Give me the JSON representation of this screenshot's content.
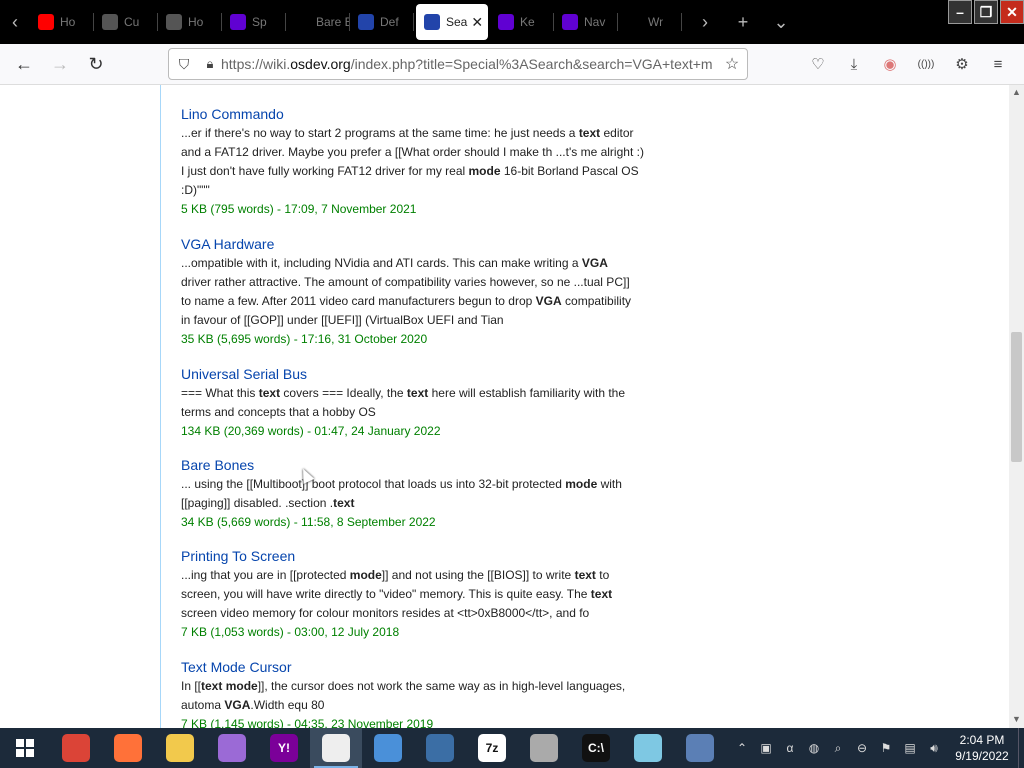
{
  "browser": {
    "tabs": [
      {
        "label": "Ho",
        "icon": "youtube-icon",
        "color": "#ff0000"
      },
      {
        "label": "Cu",
        "icon": "binary-icon",
        "color": "#555555"
      },
      {
        "label": "Ho",
        "icon": "binary-icon",
        "color": "#555555"
      },
      {
        "label": "Sp",
        "icon": "yahoo-icon",
        "color": "#6001d2"
      },
      {
        "label": "Bare Bon",
        "icon": "blank-icon",
        "color": "#000000"
      },
      {
        "label": "Def",
        "icon": "osdev-icon",
        "color": "#2244aa"
      },
      {
        "label": "Sea",
        "icon": "osdev-icon",
        "color": "#2244aa",
        "active": true
      },
      {
        "label": "Ke",
        "icon": "yahoo-icon",
        "color": "#6001d2"
      },
      {
        "label": "Nav",
        "icon": "yahoo-icon",
        "color": "#6001d2"
      },
      {
        "label": "Wr",
        "icon": "blank-icon",
        "color": "#000000"
      }
    ],
    "url_prefix": "https://wiki.",
    "url_domain": "osdev.org",
    "url_rest": "/index.php?title=Special%3ASearch&search=VGA+text+m"
  },
  "results": [
    {
      "title": "Lino Commando",
      "snippet": [
        [
          {
            "t": "...er if there's no way to start 2 programs at the same time: he just needs a "
          },
          {
            "t": "text",
            "b": true
          },
          {
            "t": " editor"
          }
        ],
        [
          {
            "t": "and a FAT12 driver. Maybe you prefer a [[What order should I make th ...t's me alright :)"
          }
        ],
        [
          {
            "t": "I just don't have fully working FAT12 driver for my real "
          },
          {
            "t": "mode",
            "b": true
          },
          {
            "t": " 16-bit Borland Pascal OS"
          }
        ],
        [
          {
            "t": ":D)\"\"\""
          }
        ]
      ],
      "meta": "5 KB (795 words) - 17:09, 7 November 2021"
    },
    {
      "title": "VGA Hardware",
      "snippet": [
        [
          {
            "t": "...ompatible with it, including NVidia and ATI cards. This can make writing a "
          },
          {
            "t": "VGA",
            "b": true
          }
        ],
        [
          {
            "t": "driver rather attractive. The amount of compatibility varies however, so ne ...tual PC]]"
          }
        ],
        [
          {
            "t": "to name a few. After 2011 video card manufacturers begun to drop "
          },
          {
            "t": "VGA",
            "b": true
          },
          {
            "t": " compatibility"
          }
        ],
        [
          {
            "t": "in favour of [[GOP]] under [[UEFI]] (VirtualBox UEFI and Tian"
          }
        ]
      ],
      "meta": "35 KB (5,695 words) - 17:16, 31 October 2020"
    },
    {
      "title": "Universal Serial Bus",
      "snippet": [
        [
          {
            "t": "=== What this "
          },
          {
            "t": "text",
            "b": true
          },
          {
            "t": " covers === Ideally, the "
          },
          {
            "t": "text",
            "b": true
          },
          {
            "t": " here will establish familiarity with the"
          }
        ],
        [
          {
            "t": "terms and concepts that a hobby OS"
          }
        ]
      ],
      "meta": "134 KB (20,369 words) - 01:47, 24 January 2022"
    },
    {
      "title": "Bare Bones",
      "snippet": [
        [
          {
            "t": "... using the [[Multiboot]] boot protocol that loads us into 32-bit protected "
          },
          {
            "t": "mode",
            "b": true
          },
          {
            "t": " with"
          }
        ],
        [
          {
            "t": "[[paging]] disabled. .section ."
          },
          {
            "t": "text",
            "b": true
          }
        ]
      ],
      "meta": "34 KB (5,669 words) - 11:58, 8 September 2022"
    },
    {
      "title": "Printing To Screen",
      "snippet": [
        [
          {
            "t": "...ing that you are in [[protected "
          },
          {
            "t": "mode",
            "b": true
          },
          {
            "t": "]] and not using the [[BIOS]] to write "
          },
          {
            "t": "text",
            "b": true
          },
          {
            "t": " to"
          }
        ],
        [
          {
            "t": "screen, you will have write directly to \"video\" memory. This is quite easy. The "
          },
          {
            "t": "text",
            "b": true
          }
        ],
        [
          {
            "t": "screen video memory for colour monitors resides at <tt>0xB8000</tt>, and fo"
          }
        ]
      ],
      "meta": "7 KB (1,053 words) - 03:00, 12 July 2018"
    },
    {
      "title": "Text Mode Cursor",
      "snippet": [
        [
          {
            "t": "In [["
          },
          {
            "t": "text mode",
            "b": true
          },
          {
            "t": "]], the cursor does not work the same way as in high-level languages,"
          }
        ],
        [
          {
            "t": "automa "
          },
          {
            "t": "VGA",
            "b": true
          },
          {
            "t": ".Width equ 80"
          }
        ]
      ],
      "meta": "7 KB (1,145 words) - 04:35, 23 November 2019"
    }
  ],
  "taskbar": {
    "apps": [
      {
        "name": "chrome-icon",
        "color": "#db4437",
        "label": "",
        "active": false
      },
      {
        "name": "firefox-icon",
        "color": "#ff7139",
        "label": "",
        "active": false
      },
      {
        "name": "file-explorer-icon",
        "color": "#f2c94c",
        "label": "",
        "active": false
      },
      {
        "name": "paint-icon",
        "color": "#9b6ad6",
        "label": "",
        "active": false
      },
      {
        "name": "yahoo-messenger-icon",
        "color": "#7b0099",
        "label": "Y!",
        "active": false
      },
      {
        "name": "terminal-app-icon",
        "color": "#eeeeee",
        "label": "",
        "active": true
      },
      {
        "name": "resource-monitor-icon",
        "color": "#4a90d9",
        "label": "",
        "active": false
      },
      {
        "name": "network-icon",
        "color": "#3b6ea5",
        "label": "",
        "active": false
      },
      {
        "name": "7zip-icon",
        "color": "#ffffff",
        "label": "7z",
        "active": false
      },
      {
        "name": "disc-burner-icon",
        "color": "#aaaaaa",
        "label": "",
        "active": false
      },
      {
        "name": "command-prompt-icon",
        "color": "#111111",
        "label": "C:\\",
        "active": false
      },
      {
        "name": "notepad-icon",
        "color": "#7ec8e3",
        "label": "",
        "active": false
      },
      {
        "name": "calculator-icon",
        "color": "#5b7fb5",
        "label": "",
        "active": false
      }
    ],
    "time": "2:04 PM",
    "date": "9/19/2022"
  }
}
